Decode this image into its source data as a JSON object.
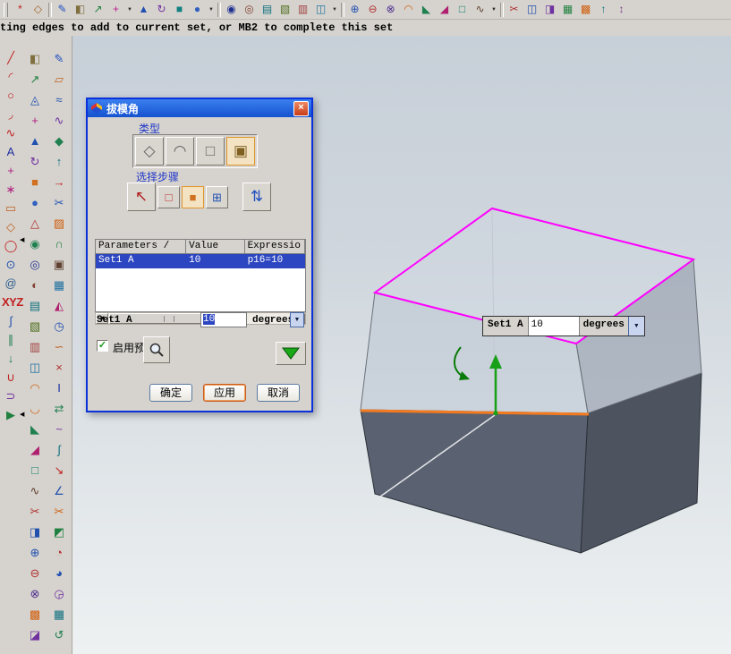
{
  "status_bar": {
    "text": "ting edges to add to current set, or MB2 to complete this set"
  },
  "glyphs": {
    "dropdown": "▼",
    "scroll_left": "◀",
    "scroll_right": "▶",
    "spinner_down": "▼",
    "close": "×",
    "check": "✓",
    "collapse_left": "◀",
    "title_icon": "◈"
  },
  "colors": {
    "highlight_magenta": "#ff00ff",
    "stationary_edge_orange": "#f47a20",
    "direction_arrow_green": "#18a018",
    "selection_blue": "#2c45c0",
    "dialog_border_blue": "#0a32dc",
    "solid_face_gray": "#5a6170"
  },
  "top_toolbar": {
    "items": [
      {
        "name": "snap-point",
        "glyph": "*",
        "color": "#c02020"
      },
      {
        "name": "work-plane",
        "glyph": "◇",
        "color": "#a06020"
      },
      {
        "kind": "sep"
      },
      {
        "name": "sketch",
        "glyph": "✎",
        "color": "#2050c0"
      },
      {
        "name": "datum-plane",
        "glyph": "◧",
        "color": "#807040"
      },
      {
        "name": "datum-axis",
        "glyph": "↗",
        "color": "#208040"
      },
      {
        "name": "point-tool",
        "glyph": "+",
        "color": "#c02090"
      },
      {
        "kind": "dropdown"
      },
      {
        "name": "extrude",
        "glyph": "▲",
        "color": "#2050b0"
      },
      {
        "name": "revolve",
        "glyph": "↻",
        "color": "#7030a0"
      },
      {
        "name": "block",
        "glyph": "■",
        "color": "#108080"
      },
      {
        "name": "cylinder",
        "glyph": "●",
        "color": "#3060c0"
      },
      {
        "kind": "dropdown"
      },
      {
        "kind": "sep"
      },
      {
        "name": "hole",
        "glyph": "◉",
        "color": "#203090"
      },
      {
        "name": "boss",
        "glyph": "◎",
        "color": "#804030"
      },
      {
        "name": "pocket",
        "glyph": "▤",
        "color": "#107080"
      },
      {
        "name": "pad",
        "glyph": "▧",
        "color": "#507020"
      },
      {
        "name": "slot",
        "glyph": "▥",
        "color": "#a04040"
      },
      {
        "name": "groove",
        "glyph": "◫",
        "color": "#2070a0"
      },
      {
        "kind": "dropdown"
      },
      {
        "kind": "sep"
      },
      {
        "name": "unite",
        "glyph": "⊕",
        "color": "#2050b0"
      },
      {
        "name": "subtract",
        "glyph": "⊖",
        "color": "#b03030"
      },
      {
        "name": "intersect",
        "glyph": "⊗",
        "color": "#503090"
      },
      {
        "name": "edge-blend",
        "glyph": "◠",
        "color": "#d06010"
      },
      {
        "name": "chamfer",
        "glyph": "◣",
        "color": "#208050"
      },
      {
        "name": "draft",
        "glyph": "◢",
        "color": "#b02070"
      },
      {
        "name": "shell",
        "glyph": "□",
        "color": "#108070"
      },
      {
        "name": "thread",
        "glyph": "∿",
        "color": "#604030"
      },
      {
        "kind": "dropdown"
      },
      {
        "kind": "sep"
      },
      {
        "name": "trim-body",
        "glyph": "✂",
        "color": "#b03030"
      },
      {
        "name": "split-body",
        "glyph": "◫",
        "color": "#2050b0"
      },
      {
        "name": "mirror-body",
        "glyph": "◨",
        "color": "#7030a0"
      },
      {
        "name": "instance-array",
        "glyph": "▦",
        "color": "#208040"
      },
      {
        "name": "sew",
        "glyph": "▩",
        "color": "#d06010"
      },
      {
        "name": "offset-face",
        "glyph": "↑",
        "color": "#107080"
      },
      {
        "name": "scale-body",
        "glyph": "↕",
        "color": "#804090"
      }
    ]
  },
  "left_toolbars": {
    "curve": {
      "items": [
        {
          "name": "line",
          "glyph": "╱",
          "color": "#c02020"
        },
        {
          "name": "arc",
          "glyph": "◜",
          "color": "#c02020"
        },
        {
          "name": "circle",
          "glyph": "○",
          "color": "#c02020"
        },
        {
          "name": "fillet-curve",
          "glyph": "◞",
          "color": "#c02020"
        },
        {
          "name": "spline",
          "glyph": "∿",
          "color": "#c02020"
        },
        {
          "name": "text",
          "glyph": "A",
          "color": "#2030a0"
        },
        {
          "name": "point",
          "glyph": "+",
          "color": "#b02080"
        },
        {
          "name": "point-set",
          "glyph": "∗",
          "color": "#b02080"
        },
        {
          "name": "rectangle",
          "glyph": "▭",
          "color": "#c06020"
        },
        {
          "name": "polygon",
          "glyph": "◇",
          "color": "#c06020"
        },
        {
          "name": "ellipse",
          "glyph": "◯",
          "color": "#c02020"
        },
        {
          "name": "circle-point",
          "glyph": "⊙",
          "color": "#2050b0"
        },
        {
          "name": "helix",
          "glyph": "@",
          "color": "#306090"
        },
        {
          "name": "csys",
          "glyph": "XYZ",
          "color": "#c02020"
        },
        {
          "name": "law-curve",
          "glyph": "∫",
          "color": "#2050b0"
        },
        {
          "name": "offset-curve",
          "glyph": "∥",
          "color": "#208050"
        },
        {
          "name": "project-curve",
          "glyph": "↓",
          "color": "#208050"
        },
        {
          "name": "bridge-curve",
          "glyph": "∪",
          "color": "#c02020"
        },
        {
          "name": "join-curve",
          "glyph": "⊃",
          "color": "#7030a0"
        },
        {
          "name": "direction",
          "glyph": "▶",
          "color": "#208040"
        }
      ]
    },
    "feature": {
      "items": [
        {
          "name": "datum-plane",
          "glyph": "◧",
          "color": "#807040"
        },
        {
          "name": "datum-axis",
          "glyph": "↗",
          "color": "#208040"
        },
        {
          "name": "datum-csys",
          "glyph": "◬",
          "color": "#2050b0"
        },
        {
          "name": "point-feature",
          "glyph": "+",
          "color": "#b02080"
        },
        {
          "name": "extrude",
          "glyph": "▲",
          "color": "#2050b0"
        },
        {
          "name": "revolve",
          "glyph": "↻",
          "color": "#7030a0"
        },
        {
          "name": "block",
          "glyph": "■",
          "color": "#d07020"
        },
        {
          "name": "cylinder",
          "glyph": "●",
          "color": "#3060c0"
        },
        {
          "name": "cone",
          "glyph": "△",
          "color": "#b03030"
        },
        {
          "name": "sphere",
          "glyph": "◉",
          "color": "#208050"
        },
        {
          "name": "hole",
          "glyph": "◎",
          "color": "#203090"
        },
        {
          "name": "boss",
          "glyph": "◐",
          "color": "#804030"
        },
        {
          "name": "pocket",
          "glyph": "▤",
          "color": "#107080"
        },
        {
          "name": "pad",
          "glyph": "▧",
          "color": "#507020"
        },
        {
          "name": "slot",
          "glyph": "▥",
          "color": "#a04040"
        },
        {
          "name": "groove",
          "glyph": "◫",
          "color": "#2070a0"
        },
        {
          "name": "edge-blend",
          "glyph": "◠",
          "color": "#d06010"
        },
        {
          "name": "face-blend",
          "glyph": "◡",
          "color": "#d06010"
        },
        {
          "name": "chamfer",
          "glyph": "◣",
          "color": "#208050"
        },
        {
          "name": "draft",
          "glyph": "◢",
          "color": "#b02070"
        },
        {
          "name": "shell",
          "glyph": "□",
          "color": "#108070"
        },
        {
          "name": "thread",
          "glyph": "∿",
          "color": "#604030"
        },
        {
          "name": "trim",
          "glyph": "✂",
          "color": "#b03030"
        },
        {
          "name": "split",
          "glyph": "◨",
          "color": "#2050b0"
        },
        {
          "name": "unite",
          "glyph": "⊕",
          "color": "#2050b0"
        },
        {
          "name": "subtract",
          "glyph": "⊖",
          "color": "#b03030"
        },
        {
          "name": "intersect",
          "glyph": "⊗",
          "color": "#503090"
        },
        {
          "name": "sew",
          "glyph": "▩",
          "color": "#d06010"
        },
        {
          "name": "mirror-feature",
          "glyph": "◪",
          "color": "#7030a0"
        }
      ]
    },
    "surface": {
      "items": [
        {
          "name": "sketch-tool",
          "glyph": "✎",
          "color": "#2050c0"
        },
        {
          "name": "ruled",
          "glyph": "▱",
          "color": "#c06020"
        },
        {
          "name": "through-curves",
          "glyph": "≈",
          "color": "#2050b0"
        },
        {
          "name": "swept",
          "glyph": "∿",
          "color": "#7030a0"
        },
        {
          "name": "n-sided",
          "glyph": "◆",
          "color": "#208050"
        },
        {
          "name": "offset-surface",
          "glyph": "↑",
          "color": "#107080"
        },
        {
          "name": "extension",
          "glyph": "→",
          "color": "#c02020"
        },
        {
          "name": "trim-sheet",
          "glyph": "✂",
          "color": "#2050b0"
        },
        {
          "name": "fill-surface",
          "glyph": "▨",
          "color": "#d06010"
        },
        {
          "name": "bridge-surface",
          "glyph": "∩",
          "color": "#208040"
        },
        {
          "name": "thicken",
          "glyph": "▣",
          "color": "#604030"
        },
        {
          "name": "quilt",
          "glyph": "▦",
          "color": "#2070a0"
        },
        {
          "name": "emboss",
          "glyph": "◭",
          "color": "#b02070"
        },
        {
          "name": "wrap",
          "glyph": "◷",
          "color": "#2050b0"
        },
        {
          "name": "deform",
          "glyph": "∽",
          "color": "#c06020"
        },
        {
          "name": "x-form",
          "glyph": "×",
          "color": "#b03030"
        },
        {
          "name": "i-form",
          "glyph": "I",
          "color": "#2030a0"
        },
        {
          "name": "match-edge",
          "glyph": "⇄",
          "color": "#208050"
        },
        {
          "name": "smooth-pole",
          "glyph": "~",
          "color": "#7030a0"
        },
        {
          "name": "fair-surface",
          "glyph": "∫",
          "color": "#107080"
        },
        {
          "name": "enlarge",
          "glyph": "↘",
          "color": "#c02020"
        },
        {
          "name": "law-extension",
          "glyph": "∠",
          "color": "#2050b0"
        },
        {
          "name": "snip-surface",
          "glyph": "✂",
          "color": "#d06010"
        },
        {
          "name": "reflect",
          "glyph": "◩",
          "color": "#208040"
        },
        {
          "name": "analyze-face",
          "glyph": "◔",
          "color": "#b03030"
        },
        {
          "name": "curvature",
          "glyph": "◕",
          "color": "#2050b0"
        },
        {
          "name": "section-analysis",
          "glyph": "◶",
          "color": "#7030a0"
        },
        {
          "name": "grid-analysis",
          "glyph": "▦",
          "color": "#107080"
        },
        {
          "name": "refresh",
          "glyph": "↺",
          "color": "#208050"
        }
      ]
    }
  },
  "dialog": {
    "title": "拔模角",
    "type_label": "类型",
    "type_buttons": [
      {
        "name": "draft-from-plane",
        "glyph": "◇",
        "color": "#606060",
        "cls": "dbtn big"
      },
      {
        "name": "draft-from-edges",
        "glyph": "◠",
        "color": "#606060",
        "cls": "dbtn big"
      },
      {
        "name": "draft-tangent-to-faces",
        "glyph": "□",
        "color": "#606060",
        "cls": "dbtn big"
      },
      {
        "name": "draft-to-parting-edge",
        "glyph": "▣",
        "color": "#806020",
        "cls": "dbtn big sel"
      }
    ],
    "steps_label": "选择步骤",
    "step_buttons": [
      {
        "name": "select-edges",
        "glyph": "↖",
        "color": "#b02020",
        "cls": "dbtn big"
      },
      {
        "name": "stationary-edge",
        "glyph": "□",
        "color": "#c03030",
        "cls": "dbtn mid"
      },
      {
        "name": "faces-to-draft",
        "glyph": "■",
        "color": "#d07020",
        "cls": "dbtn mid sel"
      },
      {
        "name": "add-new-set",
        "glyph": "⊞",
        "color": "#2050b0",
        "cls": "dbtn mid"
      },
      {
        "name": "flip-draft-direction",
        "glyph": "⇅",
        "color": "#2050c0",
        "cls": "dbtn big gap"
      }
    ],
    "table": {
      "columns": [
        "Parameters /",
        "Value",
        "Expressio"
      ],
      "rows": [
        {
          "parameter": "Set1 A",
          "value": "10",
          "expression": "p16=10"
        }
      ]
    },
    "angle_row": {
      "label": "Set1 A",
      "value": "10",
      "unit": "degrees"
    },
    "preview_label": "启用预览",
    "buttons": {
      "ok": "确定",
      "apply": "应用",
      "cancel": "取消"
    }
  },
  "viewport": {
    "mini_editor": {
      "label": "Set1 A",
      "value": "10",
      "unit": "degrees"
    }
  }
}
